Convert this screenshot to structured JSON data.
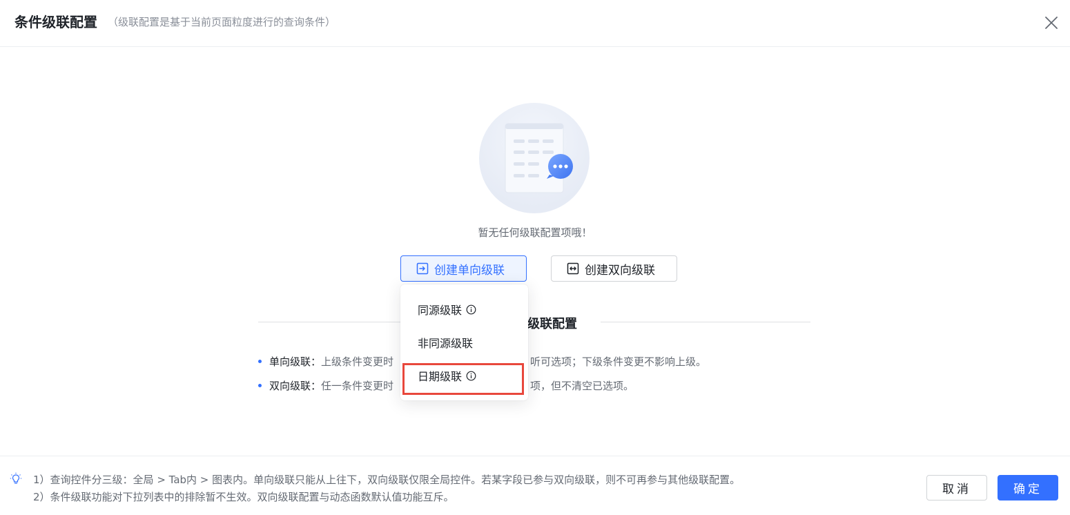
{
  "dialog": {
    "title": "条件级联配置",
    "subtitle": "（级联配置是基于当前页面粒度进行的查询条件）",
    "close_icon": "close-icon"
  },
  "empty": {
    "text": "暂无任何级联配置项哦！",
    "icon": "empty-chat-list-illustration"
  },
  "actions": {
    "create_one_way": "创建单向级联",
    "create_one_way_icon": "arrow-into-box-icon",
    "create_two_way": "创建双向级联",
    "create_two_way_icon": "double-arrow-box-icon"
  },
  "dropdown": {
    "items": [
      {
        "label": "同源级联",
        "has_info": true
      },
      {
        "label": "非同源级联",
        "has_info": false
      },
      {
        "label": "日期级联",
        "has_info": true
      }
    ],
    "highlighted_index": 2
  },
  "section": {
    "title_visible": "件级联配置",
    "items": [
      {
        "label": "单向级联：",
        "text_a": "上级条件变更时",
        "text_b": "听可选项；下级条件变更不影响上级。"
      },
      {
        "label": "双向级联：",
        "text_a": "任一条件变更时",
        "text_b": "项，但不清空已选项。"
      }
    ]
  },
  "footer": {
    "tip_icon": "lightbulb-icon",
    "tips": [
      "1）查询控件分三级：全局 > Tab内 > 图表内。单向级联只能从上往下，双向级联仅限全局控件。若某字段已参与双向级联，则不可再参与其他级联配置。",
      "2）条件级联功能对下拉列表中的排除暂不生效。双向级联配置与动态函数默认值功能互斥。"
    ],
    "cancel": "取消",
    "confirm": "确定"
  },
  "colors": {
    "primary": "#3370ff",
    "highlight_border": "#e8473c"
  }
}
